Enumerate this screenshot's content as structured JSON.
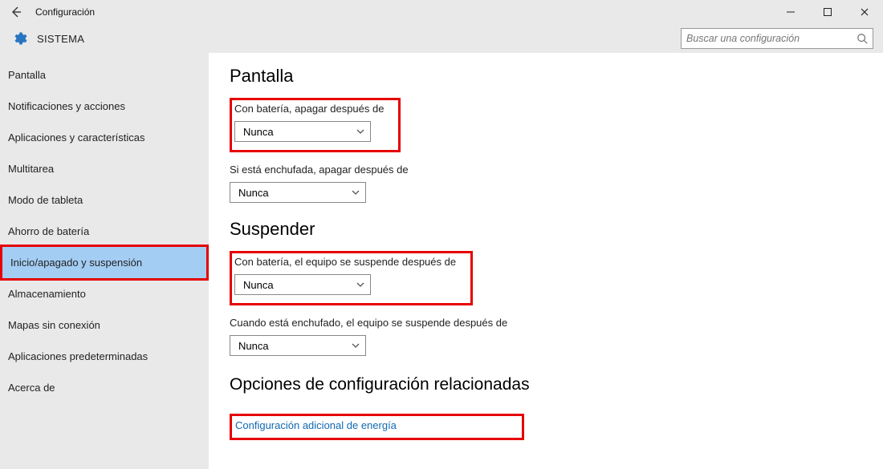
{
  "titlebar": {
    "title": "Configuración"
  },
  "header": {
    "section_title": "SISTEMA",
    "search_placeholder": "Buscar una configuración"
  },
  "sidebar": {
    "items": [
      {
        "label": "Pantalla"
      },
      {
        "label": "Notificaciones y acciones"
      },
      {
        "label": "Aplicaciones y características"
      },
      {
        "label": "Multitarea"
      },
      {
        "label": "Modo de tableta"
      },
      {
        "label": "Ahorro de batería"
      },
      {
        "label": "Inicio/apagado y suspensión"
      },
      {
        "label": "Almacenamiento"
      },
      {
        "label": "Mapas sin conexión"
      },
      {
        "label": "Aplicaciones predeterminadas"
      },
      {
        "label": "Acerca de"
      }
    ]
  },
  "content": {
    "section_display": "Pantalla",
    "battery_screen_label": "Con batería, apagar después de",
    "battery_screen_value": "Nunca",
    "plugged_screen_label": "Si está enchufada, apagar después de",
    "plugged_screen_value": "Nunca",
    "section_suspend": "Suspender",
    "battery_suspend_label": "Con batería, el equipo se suspende después de",
    "battery_suspend_value": "Nunca",
    "plugged_suspend_label": "Cuando está enchufado, el equipo se suspende después de",
    "plugged_suspend_value": "Nunca",
    "section_related": "Opciones de configuración relacionadas",
    "related_link": "Configuración adicional de energía"
  }
}
